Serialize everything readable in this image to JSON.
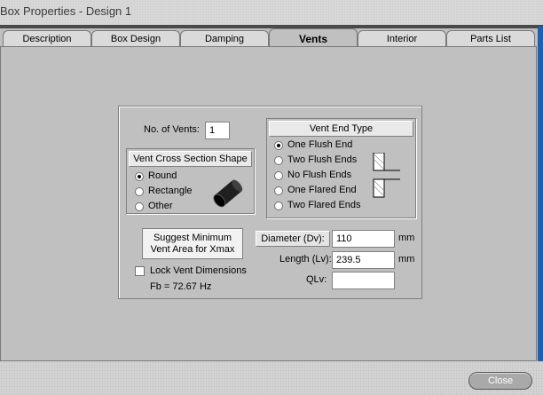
{
  "window": {
    "title": "Box Properties - Design 1"
  },
  "tabs": [
    "Description",
    "Box Design",
    "Damping",
    "Vents",
    "Interior",
    "Parts List"
  ],
  "active_tab": "Vents",
  "vents": {
    "count_label": "No. of Vents:",
    "count_value": "1",
    "cross_section": {
      "header": "Vent Cross Section Shape",
      "options": [
        "Round",
        "Rectangle",
        "Other"
      ],
      "selected": "Round"
    },
    "end_type": {
      "header": "Vent End Type",
      "options": [
        "One Flush End",
        "Two Flush Ends",
        "No Flush Ends",
        "One Flared End",
        "Two Flared Ends"
      ],
      "selected": "One Flush End"
    },
    "suggest_button": {
      "line1": "Suggest Minimum",
      "line2": "Vent Area for Xmax"
    },
    "lock_dimensions": {
      "label": "Lock Vent Dimensions",
      "checked": false
    },
    "fb_text": "Fb = 72.67 Hz",
    "diameter": {
      "label": "Diameter (Dv):",
      "value": "110",
      "unit": "mm"
    },
    "length": {
      "label": "Length (Lv):",
      "value": "239.5",
      "unit": "mm"
    },
    "qlv": {
      "label": "QLv:",
      "value": ""
    }
  },
  "footer": {
    "close_label": "Close"
  },
  "icons": [
    "cylinder-icon",
    "flush-end-icon"
  ]
}
